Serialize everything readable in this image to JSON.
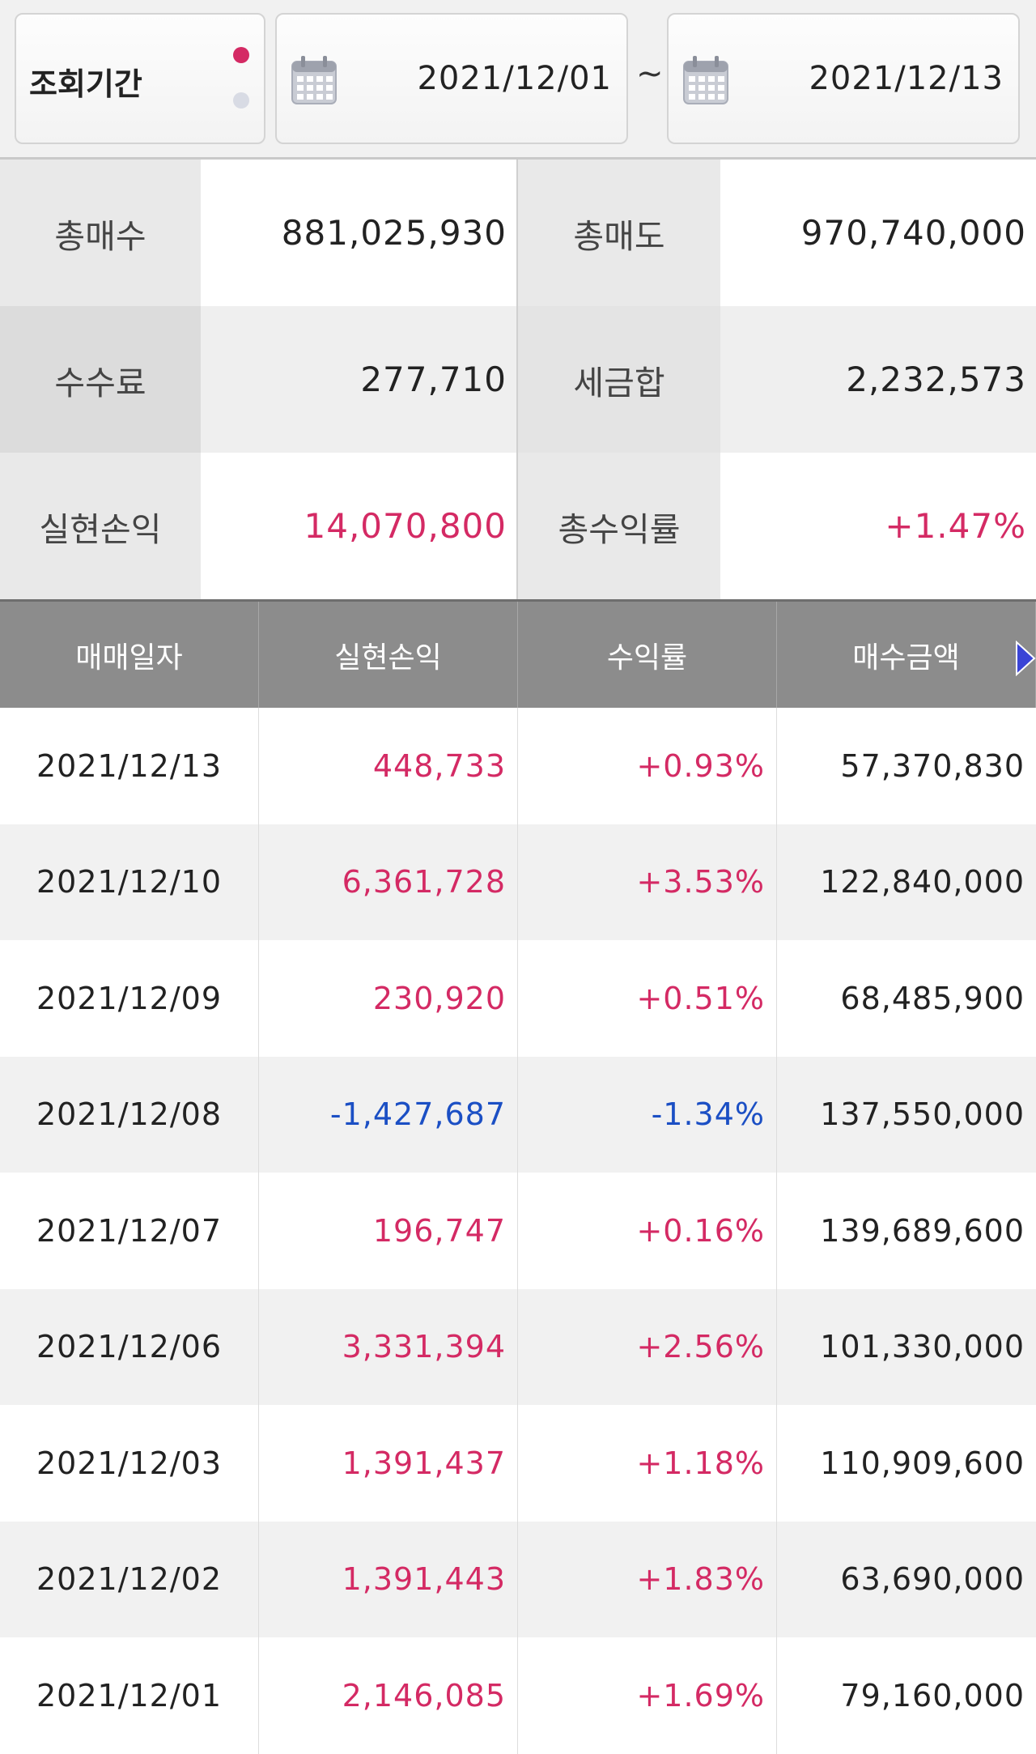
{
  "filter": {
    "period_label": "조회기간",
    "start_date": "2021/12/01",
    "separator": "~",
    "end_date": "2021/12/13",
    "calendar_icon": "calendar-icon",
    "colors": {
      "active_dot": "#d42a64",
      "inactive_dot": "#d8dbe4"
    }
  },
  "summary": {
    "total_buy_label": "총매수",
    "total_buy": "881,025,930",
    "total_sell_label": "총매도",
    "total_sell": "970,740,000",
    "fee_label": "수수료",
    "fee": "277,710",
    "tax_label": "세금합",
    "tax": "2,232,573",
    "realized_label": "실현손익",
    "realized": "14,070,800",
    "return_label": "총수익률",
    "return": "+1.47%"
  },
  "table": {
    "headers": [
      "매매일자",
      "실현손익",
      "수익률",
      "매수금액"
    ],
    "scroll_icon": "scroll-right-arrow-icon",
    "colors": {
      "positive": "#d42a64",
      "negative": "#1b4fc4",
      "header_bg": "#8c8c8c"
    },
    "rows": [
      {
        "date": "2021/12/13",
        "pnl": "448,733",
        "rate": "+0.93%",
        "buy": "57,370,830",
        "sign": "pos"
      },
      {
        "date": "2021/12/10",
        "pnl": "6,361,728",
        "rate": "+3.53%",
        "buy": "122,840,000",
        "sign": "pos"
      },
      {
        "date": "2021/12/09",
        "pnl": "230,920",
        "rate": "+0.51%",
        "buy": "68,485,900",
        "sign": "pos"
      },
      {
        "date": "2021/12/08",
        "pnl": "-1,427,687",
        "rate": "-1.34%",
        "buy": "137,550,000",
        "sign": "neg"
      },
      {
        "date": "2021/12/07",
        "pnl": "196,747",
        "rate": "+0.16%",
        "buy": "139,689,600",
        "sign": "pos"
      },
      {
        "date": "2021/12/06",
        "pnl": "3,331,394",
        "rate": "+2.56%",
        "buy": "101,330,000",
        "sign": "pos"
      },
      {
        "date": "2021/12/03",
        "pnl": "1,391,437",
        "rate": "+1.18%",
        "buy": "110,909,600",
        "sign": "pos"
      },
      {
        "date": "2021/12/02",
        "pnl": "1,391,443",
        "rate": "+1.83%",
        "buy": "63,690,000",
        "sign": "pos"
      },
      {
        "date": "2021/12/01",
        "pnl": "2,146,085",
        "rate": "+1.69%",
        "buy": "79,160,000",
        "sign": "pos"
      }
    ]
  }
}
